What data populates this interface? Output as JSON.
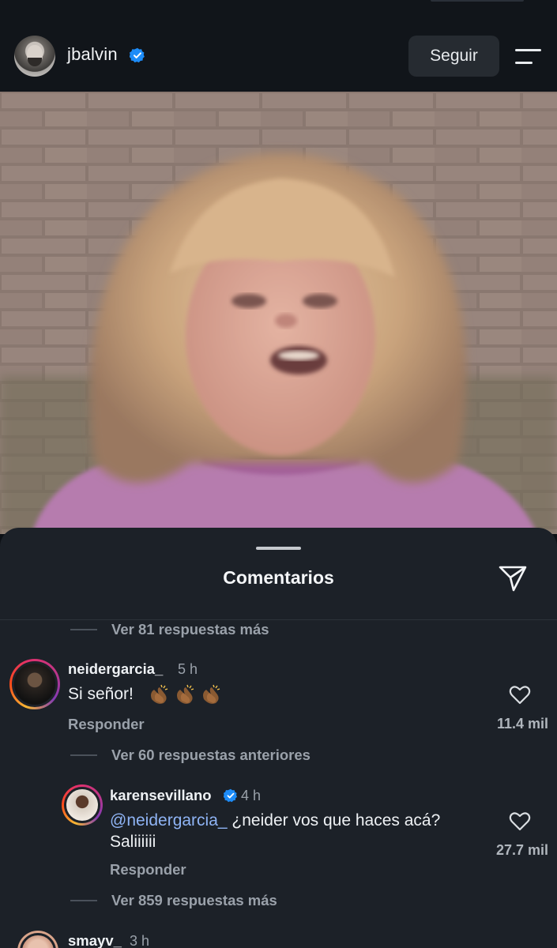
{
  "header": {
    "username": "jbalvin",
    "follow_label": "Seguir",
    "icons": {
      "verified": "verified-badge-icon",
      "menu": "menu-icon",
      "avatar": "profile-avatar"
    }
  },
  "post": {
    "media": "photo"
  },
  "comments_sheet": {
    "title": "Comentarios",
    "share_icon": "send-icon",
    "top_more_replies": "Ver 81 respuestas más",
    "comments": [
      {
        "username": "neidergarcia_",
        "time": "5 h",
        "text": "Si señor!",
        "emoji": "clapping-hands-medium-dark-skin",
        "reply_label": "Responder",
        "likes": "11.4 mil"
      }
    ],
    "previous_replies": "Ver 60 respuestas anteriores",
    "reply": {
      "username": "karensevillano",
      "verified": true,
      "time": "4 h",
      "mention": "@neidergarcia_",
      "text_line1": "¿neider vos que haces acá?",
      "text_line2": "Saliiiiii",
      "reply_label": "Responder",
      "likes": "27.7 mil"
    },
    "more_replies": "Ver 859 respuestas más",
    "next_comment": {
      "username": "smayv_",
      "time": "3 h"
    }
  },
  "colors": {
    "background": "#0d1116",
    "sheet": "#1c2128",
    "text_primary": "#eef1f4",
    "text_secondary": "#9aa1aa",
    "mention": "#8fb4f5",
    "verified": "#1d8cf8"
  }
}
